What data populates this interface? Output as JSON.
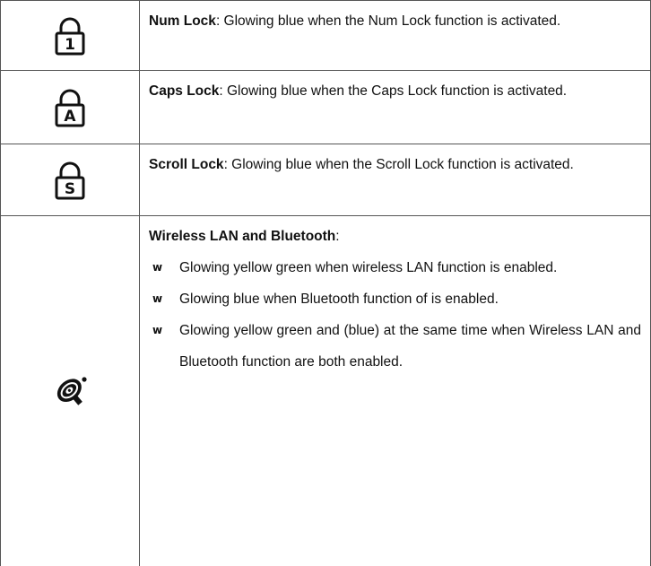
{
  "rows": [
    {
      "icon": "num-lock-icon",
      "icon_glyph": "1",
      "title": "Num Lock",
      "description": ": Glowing blue when the Num Lock function is activated."
    },
    {
      "icon": "caps-lock-icon",
      "icon_glyph": "A",
      "title": "Caps Lock",
      "description": ": Glowing blue when the Caps Lock function is activated."
    },
    {
      "icon": "scroll-lock-icon",
      "icon_glyph": "S",
      "title": "Scroll Lock",
      "description": ": Glowing blue when the Scroll Lock function is activated."
    },
    {
      "icon": "wireless-bluetooth-icon",
      "title": "Wireless LAN and Bluetooth",
      "title_suffix": ":",
      "bullet_mark": "w",
      "bullets": [
        "Glowing yellow green when wireless LAN function is enabled.",
        "Glowing blue when Bluetooth function of is enabled.",
        "Glowing yellow green and (blue) at the same time when Wireless LAN and Bluetooth function are both enabled."
      ]
    }
  ]
}
